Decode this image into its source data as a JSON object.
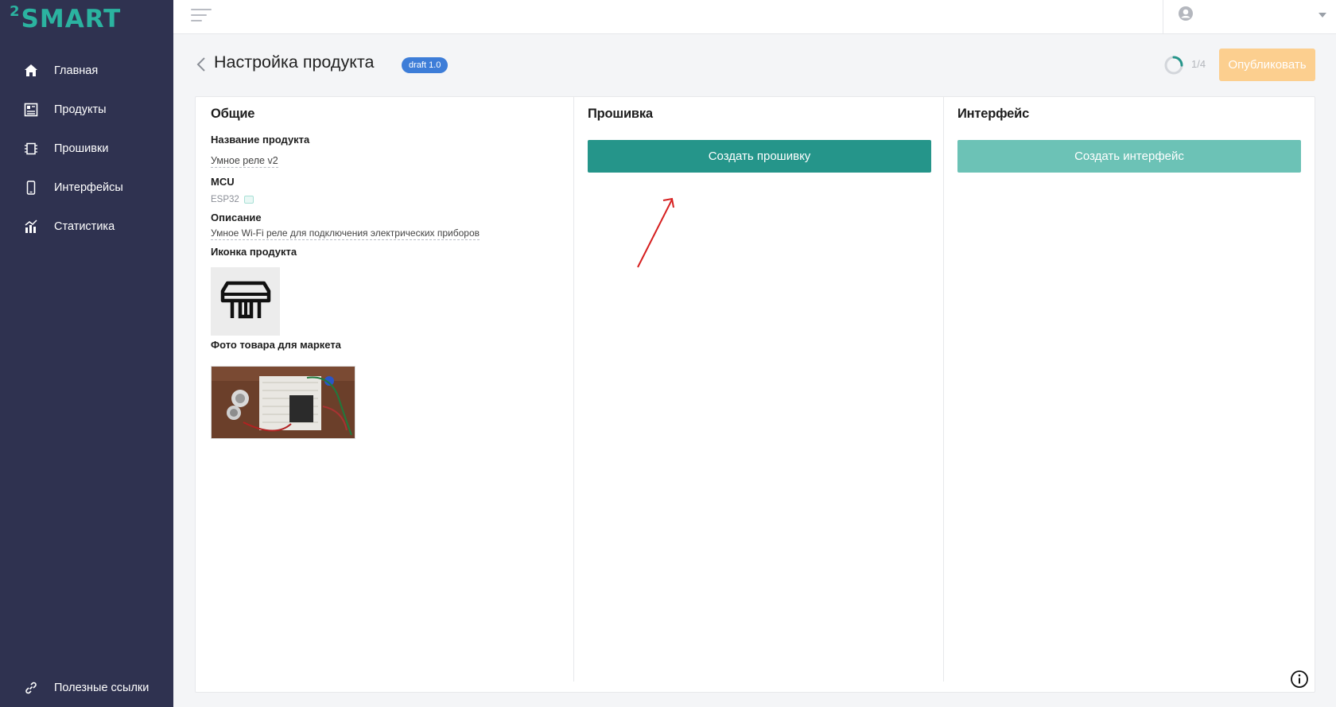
{
  "brand": {
    "logo_sup": "2",
    "logo_word": "SMART",
    "accent": "#2bb3a0"
  },
  "sidebar": {
    "items": [
      {
        "label": "Главная",
        "icon": "home-icon"
      },
      {
        "label": "Продукты",
        "icon": "products-icon"
      },
      {
        "label": "Прошивки",
        "icon": "chip-icon"
      },
      {
        "label": "Интерфейсы",
        "icon": "phone-icon"
      },
      {
        "label": "Статистика",
        "icon": "stats-icon"
      }
    ],
    "bottom_item": {
      "label": "Полезные ссылки",
      "icon": "link-icon"
    }
  },
  "topbar": {
    "menu_icon": "hamburger-icon",
    "user_icon": "user-circle-icon"
  },
  "header": {
    "title": "Настройка продукта",
    "badge": "draft 1.0",
    "progress": {
      "text": "1/4",
      "fraction": 0.25
    },
    "publish_label": "Опубликовать",
    "publish_color": "#fccf8f"
  },
  "general": {
    "title": "Общие",
    "product_name_label": "Название продукта",
    "product_name_value": "Умное реле v2",
    "mcu_label": "MCU",
    "mcu_value": "ESP32",
    "description_label": "Описание",
    "description_value": "Умное Wi-Fi реле для подключения электрических приборов",
    "icon_label": "Иконка продукта",
    "photo_label": "Фото товара для маркета"
  },
  "firmware": {
    "title": "Прошивка",
    "button_label": "Создать прошивку",
    "button_color": "#25958a"
  },
  "interface": {
    "title": "Интерфейс",
    "button_label": "Создать интерфейс",
    "button_color": "#6cc2b6"
  }
}
